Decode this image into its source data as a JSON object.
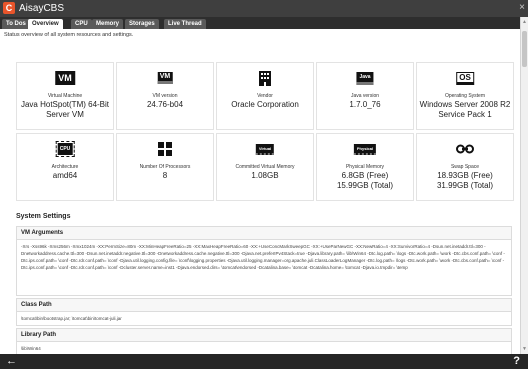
{
  "app": {
    "title": "AisayCBS",
    "logo_letter": "C",
    "close": "×"
  },
  "tabs": [
    {
      "label": "To Dos"
    },
    {
      "label": "Overview"
    },
    {
      "label": "CPU"
    },
    {
      "label": "Memory"
    },
    {
      "label": "Storages"
    },
    {
      "label": "Live Thread"
    }
  ],
  "status": "Status overview of all system resources and settings.",
  "cards": [
    {
      "icon": "vm-icon",
      "icon_text": "VM",
      "label": "Virtual Machine",
      "value": "Java HotSpot(TM) 64-Bit Server VM"
    },
    {
      "icon": "vm-version-icon",
      "icon_text": "VM",
      "label": "VM version",
      "value": "24.76-b04"
    },
    {
      "icon": "building-icon",
      "icon_text": "",
      "label": "Vendor",
      "value": "Oracle Corporation"
    },
    {
      "icon": "java-icon",
      "icon_text": "Java",
      "label": "Java version",
      "value": "1.7.0_76"
    },
    {
      "icon": "os-icon",
      "icon_text": "OS",
      "label": "Operating System",
      "value": "Windows Server 2008 R2 Service Pack 1"
    },
    {
      "icon": "cpu-icon",
      "icon_text": "CPU",
      "label": "Architecture",
      "value": "amd64"
    },
    {
      "icon": "processors-icon",
      "icon_text": "",
      "label": "Number Of Processors",
      "value": "8"
    },
    {
      "icon": "virtual-memory-icon",
      "icon_text": "Virtual",
      "label": "Committed Virtual Memory",
      "value": "1.08GB"
    },
    {
      "icon": "physical-memory-icon",
      "icon_text": "Physical",
      "label": "Physical Memory",
      "value": "6.8GB (Free)\n15.99GB (Total)"
    },
    {
      "icon": "swap-icon",
      "icon_text": "",
      "label": "Swap Space",
      "value": "18.93GB (Free)\n31.99GB (Total)"
    }
  ],
  "system_settings": {
    "title": "System Settings",
    "vm_arguments": {
      "title": "VM Arguments",
      "text": "-Xrs -Xss96k -Xms256m -Xmx1024m -XX:PermSize=80m -XX:MinHeapFreeRatio=25 -XX:MaxHeapFreeRatio=60 -XX:+UseConcMarkSweepGC -XX:+UseParNewGC -XX:NewRatio=4 -XX:SurvivorRatio=4 -Dsun.net.inetaddr.ttl=300 -Dnetworkaddress.cache.ttl=300 -Dsun.net.inetaddr.negative.ttl=300 -Dnetworkaddress.cache.negative.ttl=300 -Djava.net.preferIPv4Stack=true -Djava.library.path= \\lib\\Win64 -Dtc.log.path= \\logs -Dtc.work.path= \\work -Dtc.cbs.conf.path= \\conf -Dtc.ips.conf.path= \\conf -Dtc.rdr.conf.path= \\conf -Djava.util.logging.config.file= \\conf\\logging.properties -Djava.util.logging.manager=org.apache.juli.ClassLoaderLogManager -Dtc.log.path= \\logs -Dtc.work.path= \\work -Dtc.cbs.conf.path= \\conf -Dtc.ips.conf.path= \\conf -Dtc.rdr.conf.path= \\conf -Dcluster.server.name=inst1 -Djava.endorsed.dirs= \\tomcat\\endorsed -Dcatalina.base= \\tomcat -Dcatalina.home= \\tomcat -Djava.io.tmpdir= \\temp"
    },
    "class_path": {
      "title": "Class Path",
      "text": "\\tomcat\\bin\\bootstrap.jar; \\tomcat\\bin\\tomcat-juli.jar"
    },
    "library_path": {
      "title": "Library Path",
      "text": "\\lib\\Win64"
    }
  },
  "bottom": {
    "back": "←",
    "help": "?"
  }
}
